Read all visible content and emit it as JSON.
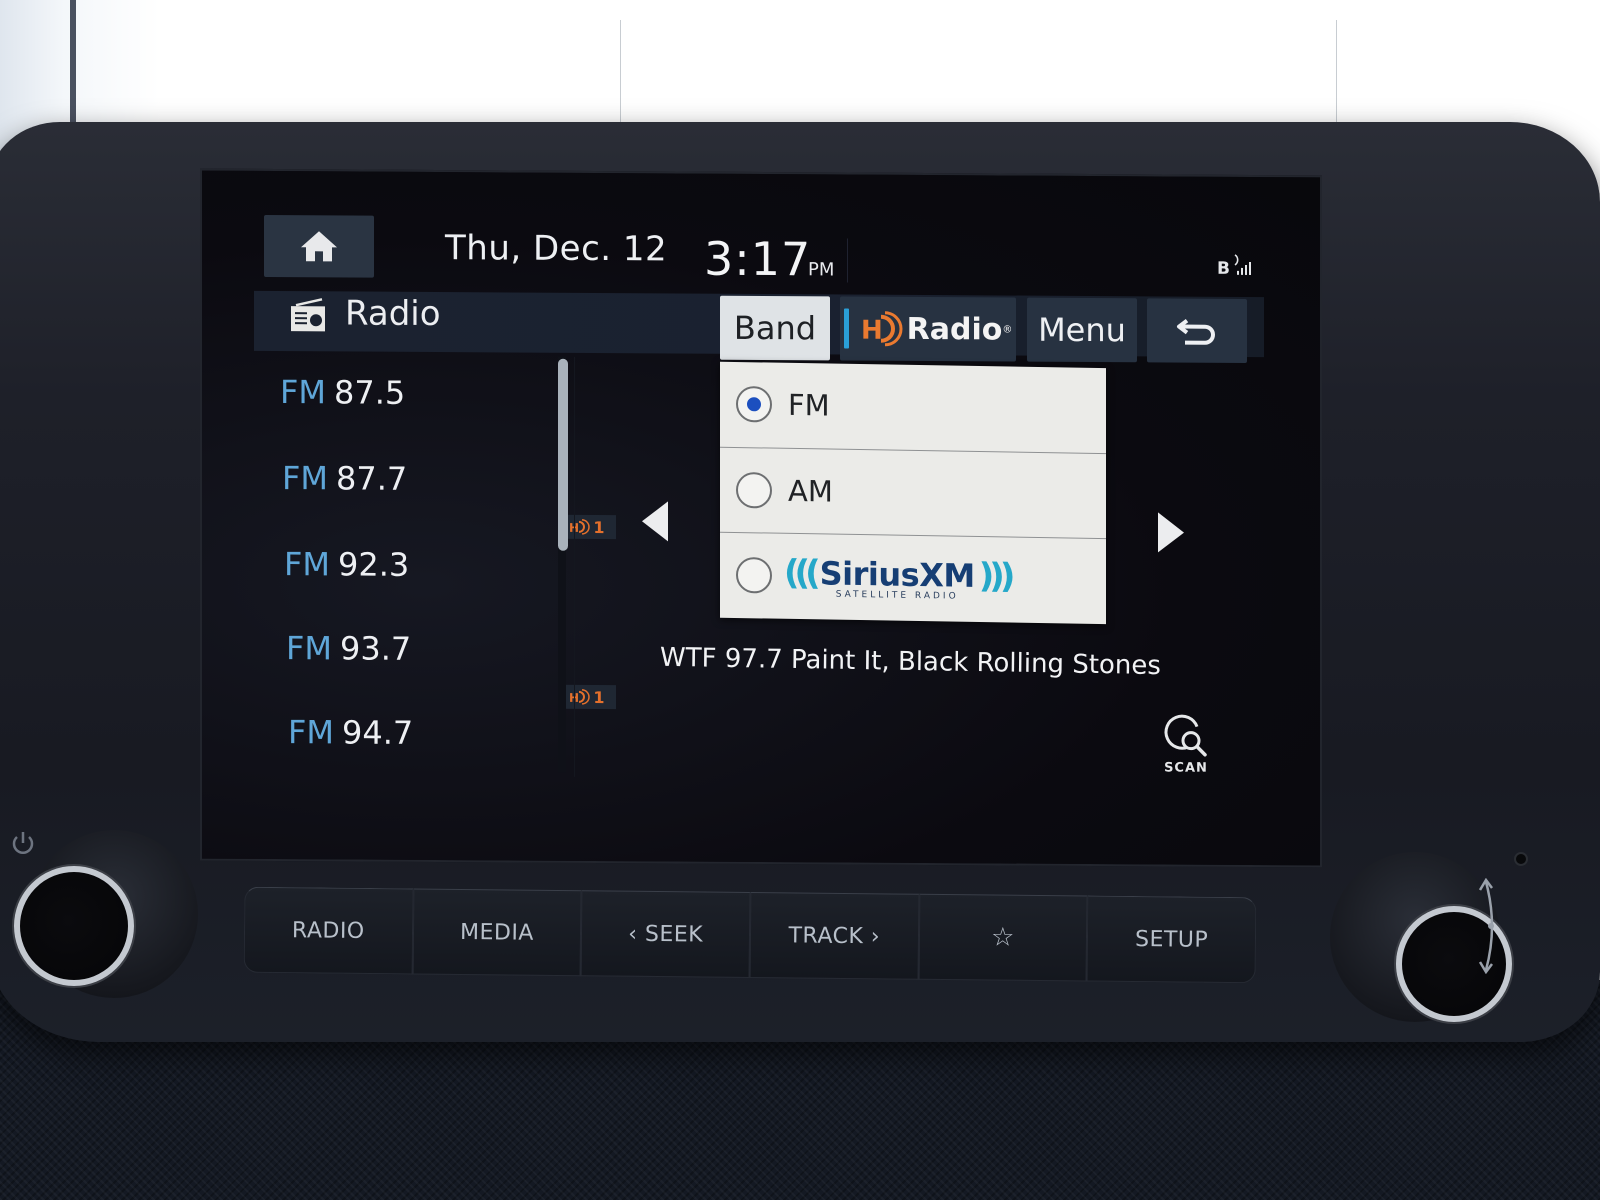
{
  "status_bar": {
    "home_icon": "home-icon",
    "date": "Thu, Dec. 12",
    "time": "3:17",
    "ampm": "PM",
    "connectivity": "B",
    "connectivity_icons": [
      "bluetooth-icon",
      "signal-bars-icon"
    ]
  },
  "title_bar": {
    "icon": "radio-icon",
    "title": "Radio",
    "buttons": {
      "band": "Band",
      "hd_radio_prefix": "HD",
      "hd_radio_label": "Radio",
      "hd_radio_reg": "®",
      "menu": "Menu",
      "back_icon": "back-arrow-icon"
    }
  },
  "station_list": {
    "items": [
      {
        "band": "FM",
        "freq": "87.5",
        "hd": null
      },
      {
        "band": "FM",
        "freq": "87.7",
        "hd": null
      },
      {
        "band": "FM",
        "freq": "92.3",
        "hd": "1"
      },
      {
        "band": "FM",
        "freq": "93.7",
        "hd": null
      },
      {
        "band": "FM",
        "freq": "94.7",
        "hd": "1"
      }
    ],
    "scroll_position": 0.0
  },
  "band_popup": {
    "options": [
      {
        "label": "FM",
        "selected": true
      },
      {
        "label": "AM",
        "selected": false
      },
      {
        "label": "SiriusXM",
        "sublabel": "SATELLITE RADIO",
        "selected": false
      }
    ]
  },
  "now_playing": {
    "text": "WTF 97.7 Paint It, Black Rolling Stones"
  },
  "controls": {
    "prev_icon": "triangle-left-icon",
    "next_icon": "triangle-right-icon",
    "scan_label": "SCAN",
    "scan_icon": "scan-search-icon"
  },
  "hardware_buttons": [
    {
      "label": "RADIO"
    },
    {
      "label": "MEDIA"
    },
    {
      "label": "‹ SEEK"
    },
    {
      "label": "TRACK ›"
    },
    {
      "label": "☆",
      "icon": "star-icon"
    },
    {
      "label": "SETUP"
    }
  ],
  "colors": {
    "accent_blue": "#5fa6d8",
    "hd_orange": "#e4702c",
    "radio_selected": "#1c4fbf",
    "sxm_blue": "#163e74",
    "sxm_teal": "#25a8c9"
  }
}
